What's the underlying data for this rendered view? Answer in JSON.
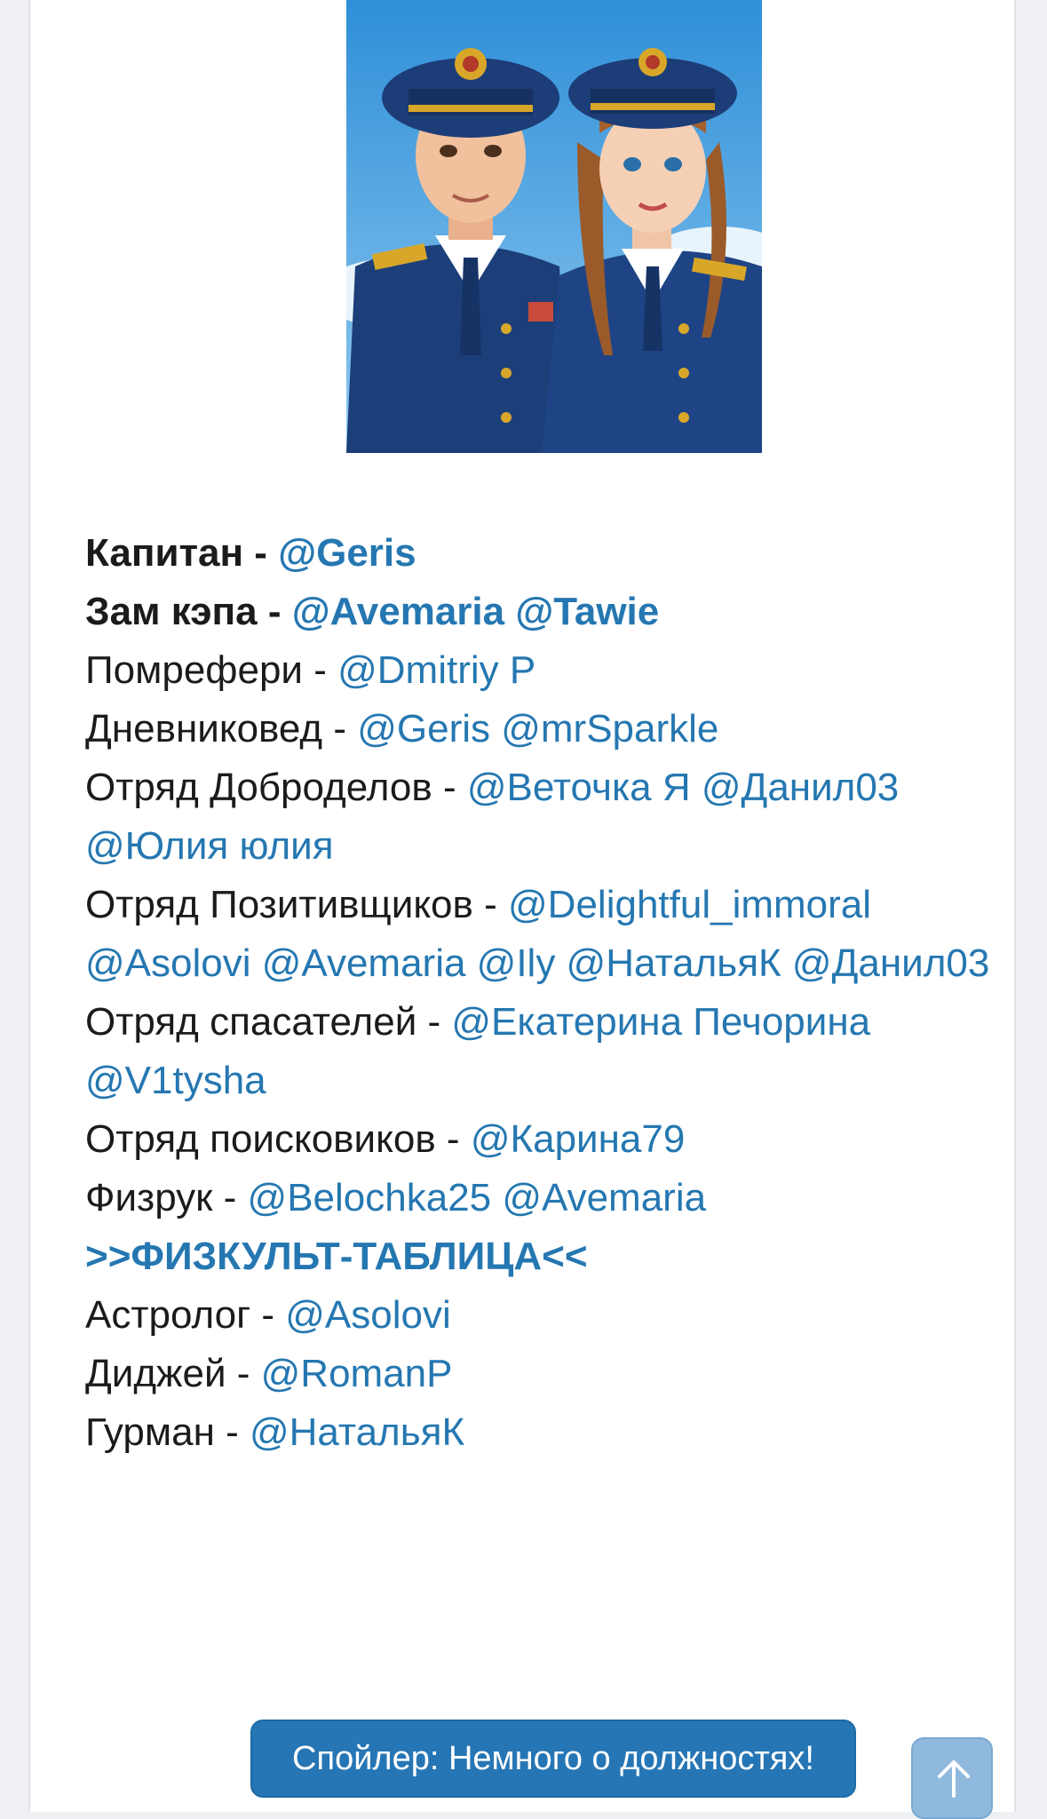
{
  "roster": {
    "captain": {
      "label": "Капитан - ",
      "handles": "@Geris"
    },
    "vice_captain": {
      "label": "Зам кэпа - ",
      "handles": "@Avemaria @Tawie"
    },
    "pomreferi": {
      "label": "Помрефери - ",
      "handles": "@Dmitriy P"
    },
    "diary_keeper": {
      "label": "Дневниковед - ",
      "handles": "@Geris @mrSparkle"
    },
    "good_deeds": {
      "label": "Отряд Доброделов - ",
      "handles": "@Веточка Я @Данил03 @Юлия юлия"
    },
    "positivity": {
      "label": "Отряд Позитивщиков - ",
      "handles": "@Delightful_immoral @Asolovi @Avemaria @Ily @НатальяК @Данил03"
    },
    "rescuers": {
      "label": "Отряд спасателей - ",
      "handles": "@Екатерина Печорина @V1tysha"
    },
    "searchers": {
      "label": "Отряд поисковиков - ",
      "handles": "@Карина79"
    },
    "pe_teacher": {
      "label": "Физрук - ",
      "handles": "@Belochka25 @Avemaria"
    },
    "pe_table_link": ">>ФИЗКУЛЬТ-ТАБЛИЦА<<",
    "astrologer": {
      "label": "Астролог - ",
      "handles": "@Asolovi"
    },
    "dj": {
      "label": "Диджей - ",
      "handles": "@RomanP"
    },
    "gourmet": {
      "label": "Гурман - ",
      "handles": "@НатальяК"
    }
  },
  "spoiler": {
    "label": "Спойлер: Немного о должностях!"
  },
  "icons": {
    "scroll_top": "arrow-up-icon"
  },
  "colors": {
    "link": "#2577b1",
    "button": "#2676b5",
    "scroll_button": "#8fb9dd",
    "text": "#1b1b1b"
  }
}
